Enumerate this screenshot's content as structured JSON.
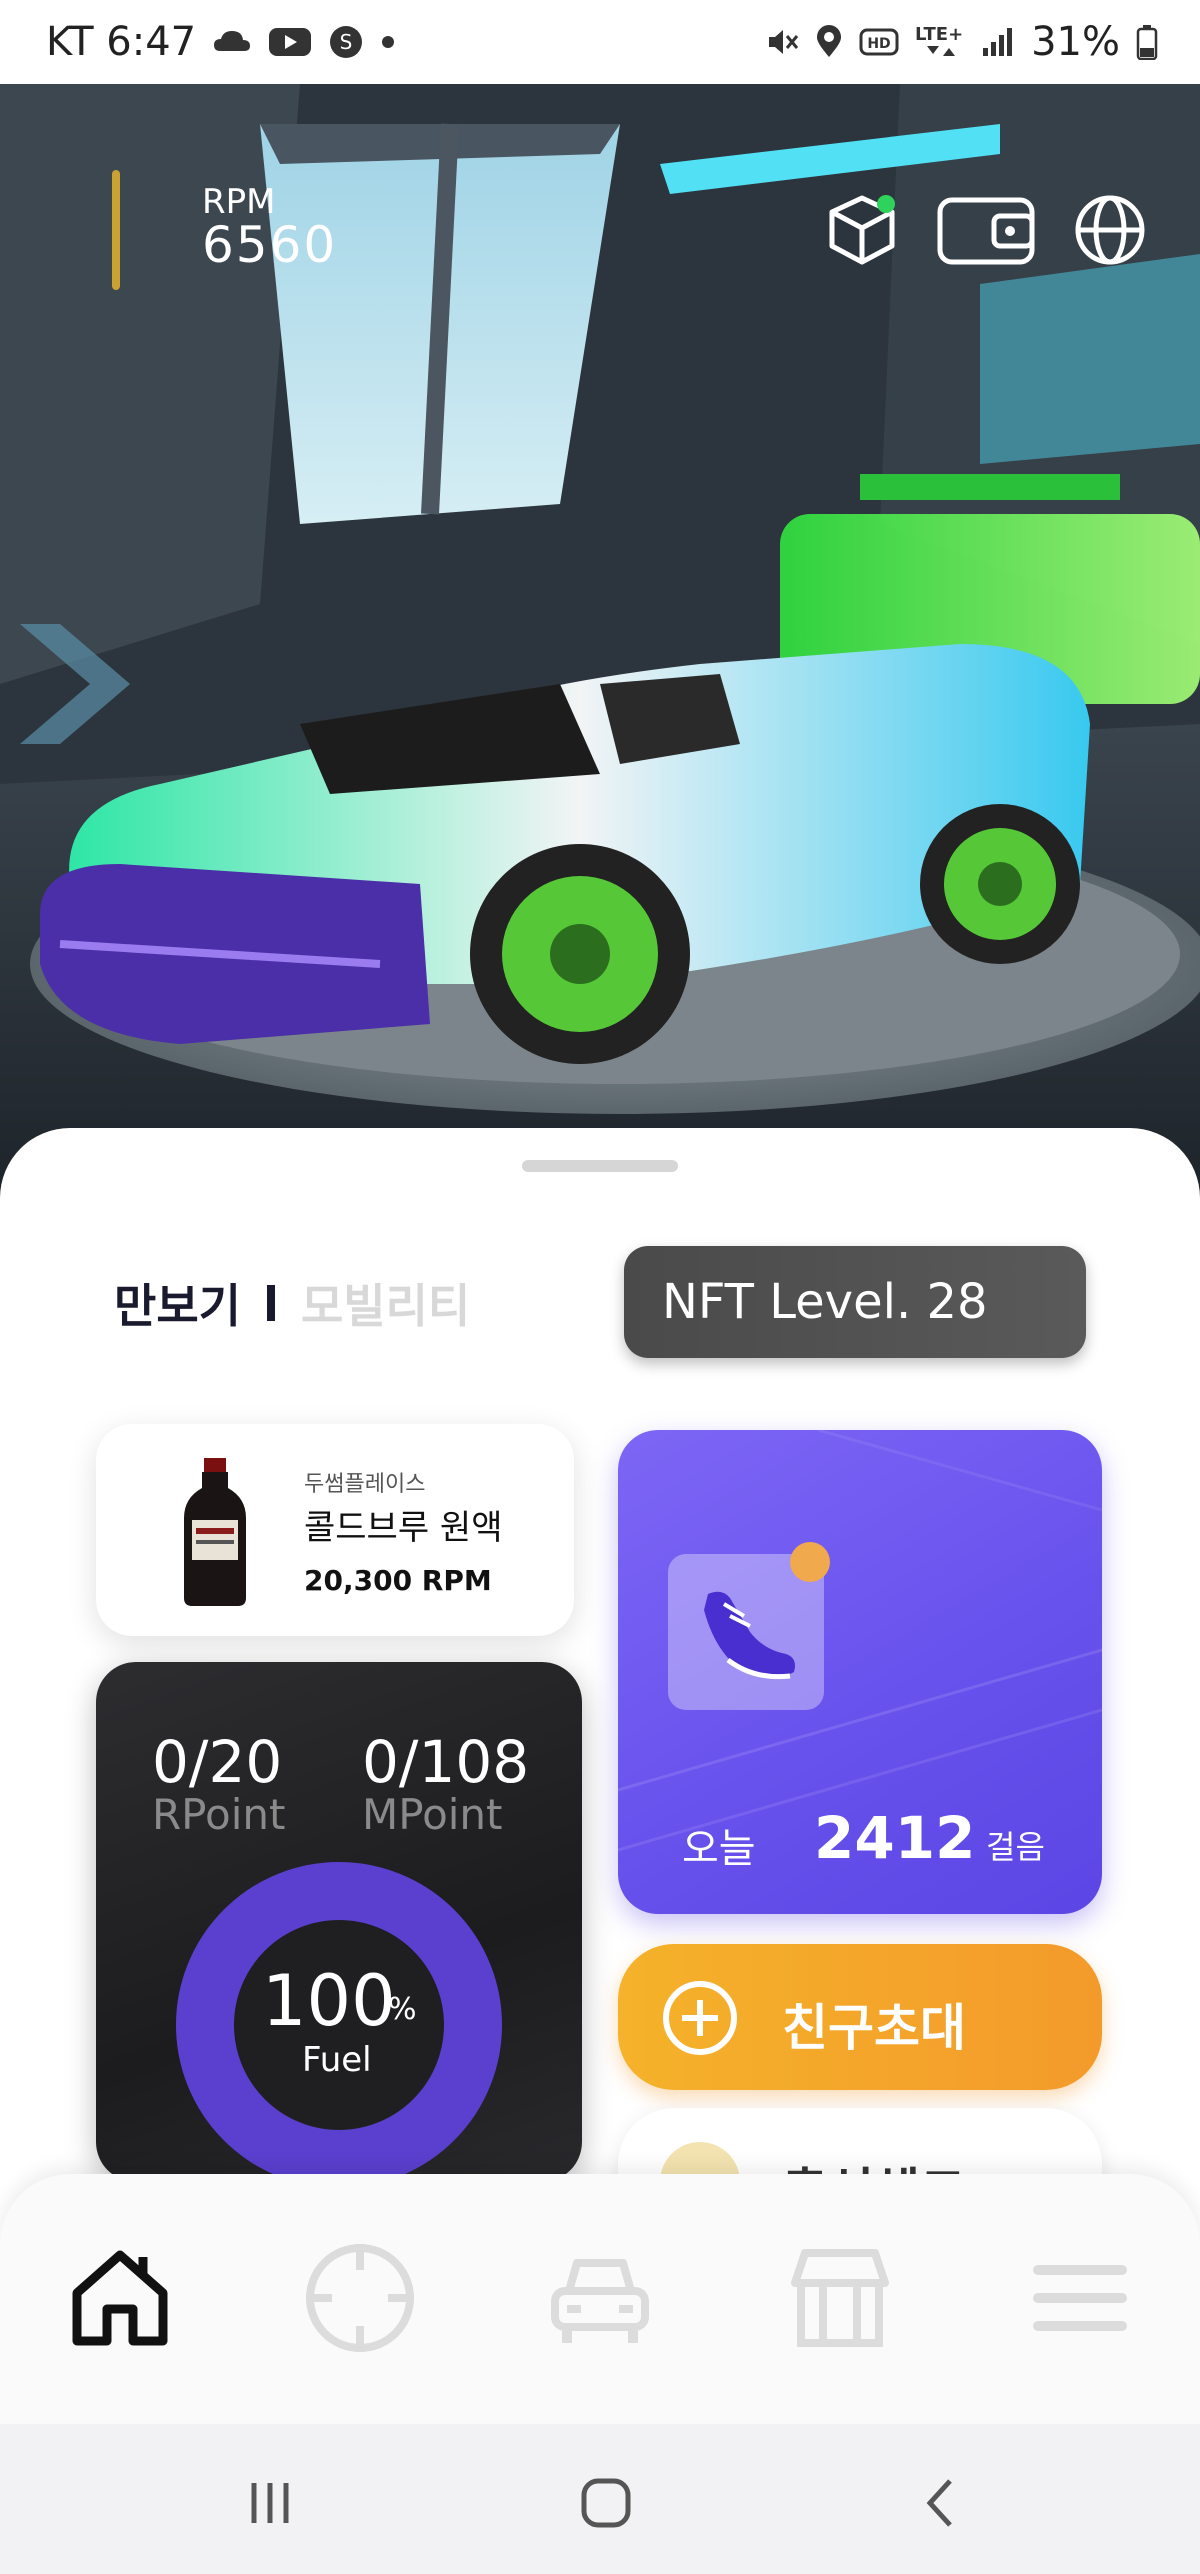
{
  "status_bar": {
    "carrier_time": "KT 6:47",
    "battery": "31%",
    "left_icons": [
      "weather-icon",
      "youtube-icon",
      "samsung-pay-icon",
      "dot-icon"
    ],
    "right_icons": [
      "mute-icon",
      "location-icon",
      "hd-icon",
      "lte-icon",
      "signal-icon",
      "battery-icon"
    ]
  },
  "hero": {
    "rpm_label": "RPM",
    "rpm_value": "6560",
    "icons": [
      "box-icon",
      "wallet-icon",
      "globe-icon"
    ]
  },
  "tabs": {
    "active": "만보기",
    "inactive": "모빌리티"
  },
  "nft_level": "NFT Level. 28",
  "product": {
    "shop": "두썸플레이스",
    "name": "콜드브루 원액",
    "price": "20,300 RPM"
  },
  "points": {
    "rpoint_value": "0/20",
    "rpoint_label": "RPoint",
    "mpoint_value": "0/108",
    "mpoint_label": "MPoint",
    "fuel_value": "100",
    "fuel_unit": "%",
    "fuel_label": "Fuel",
    "fuel_fraction": 1.0
  },
  "steps": {
    "today_label": "오늘",
    "count": "2412",
    "unit": "걸음"
  },
  "invite_label": "친구초대",
  "attendance_label": "출석체크",
  "bottom_nav": [
    "home-icon",
    "target-icon",
    "car-icon",
    "store-icon",
    "menu-icon"
  ],
  "colors": {
    "accent_purple": "#6a54ee",
    "accent_orange": "#f39a2b",
    "nft_badge": "#4a4a4a"
  }
}
